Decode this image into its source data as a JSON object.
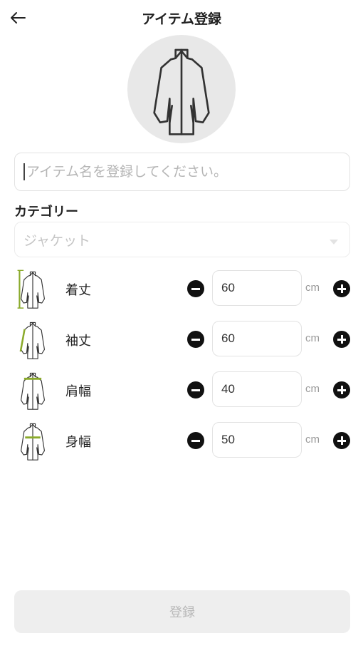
{
  "header": {
    "title": "アイテム登録",
    "back_icon": "arrow-left-icon"
  },
  "item_image": {
    "icon": "jacket-icon"
  },
  "name_field": {
    "placeholder": "アイテム名を登録してください。",
    "value": ""
  },
  "category": {
    "label": "カテゴリー",
    "selected": "ジャケット"
  },
  "measurements": [
    {
      "icon": "jacket-length-icon",
      "label": "着丈",
      "value": "60",
      "unit": "cm"
    },
    {
      "icon": "jacket-sleeve-icon",
      "label": "袖丈",
      "value": "60",
      "unit": "cm"
    },
    {
      "icon": "jacket-shoulder-icon",
      "label": "肩幅",
      "value": "40",
      "unit": "cm"
    },
    {
      "icon": "jacket-chest-icon",
      "label": "身幅",
      "value": "50",
      "unit": "cm"
    }
  ],
  "submit": {
    "label": "登録"
  },
  "colors": {
    "accent": "#8aaa2a",
    "disabled_bg": "#eeeeee",
    "disabled_text": "#b8b8b8"
  }
}
